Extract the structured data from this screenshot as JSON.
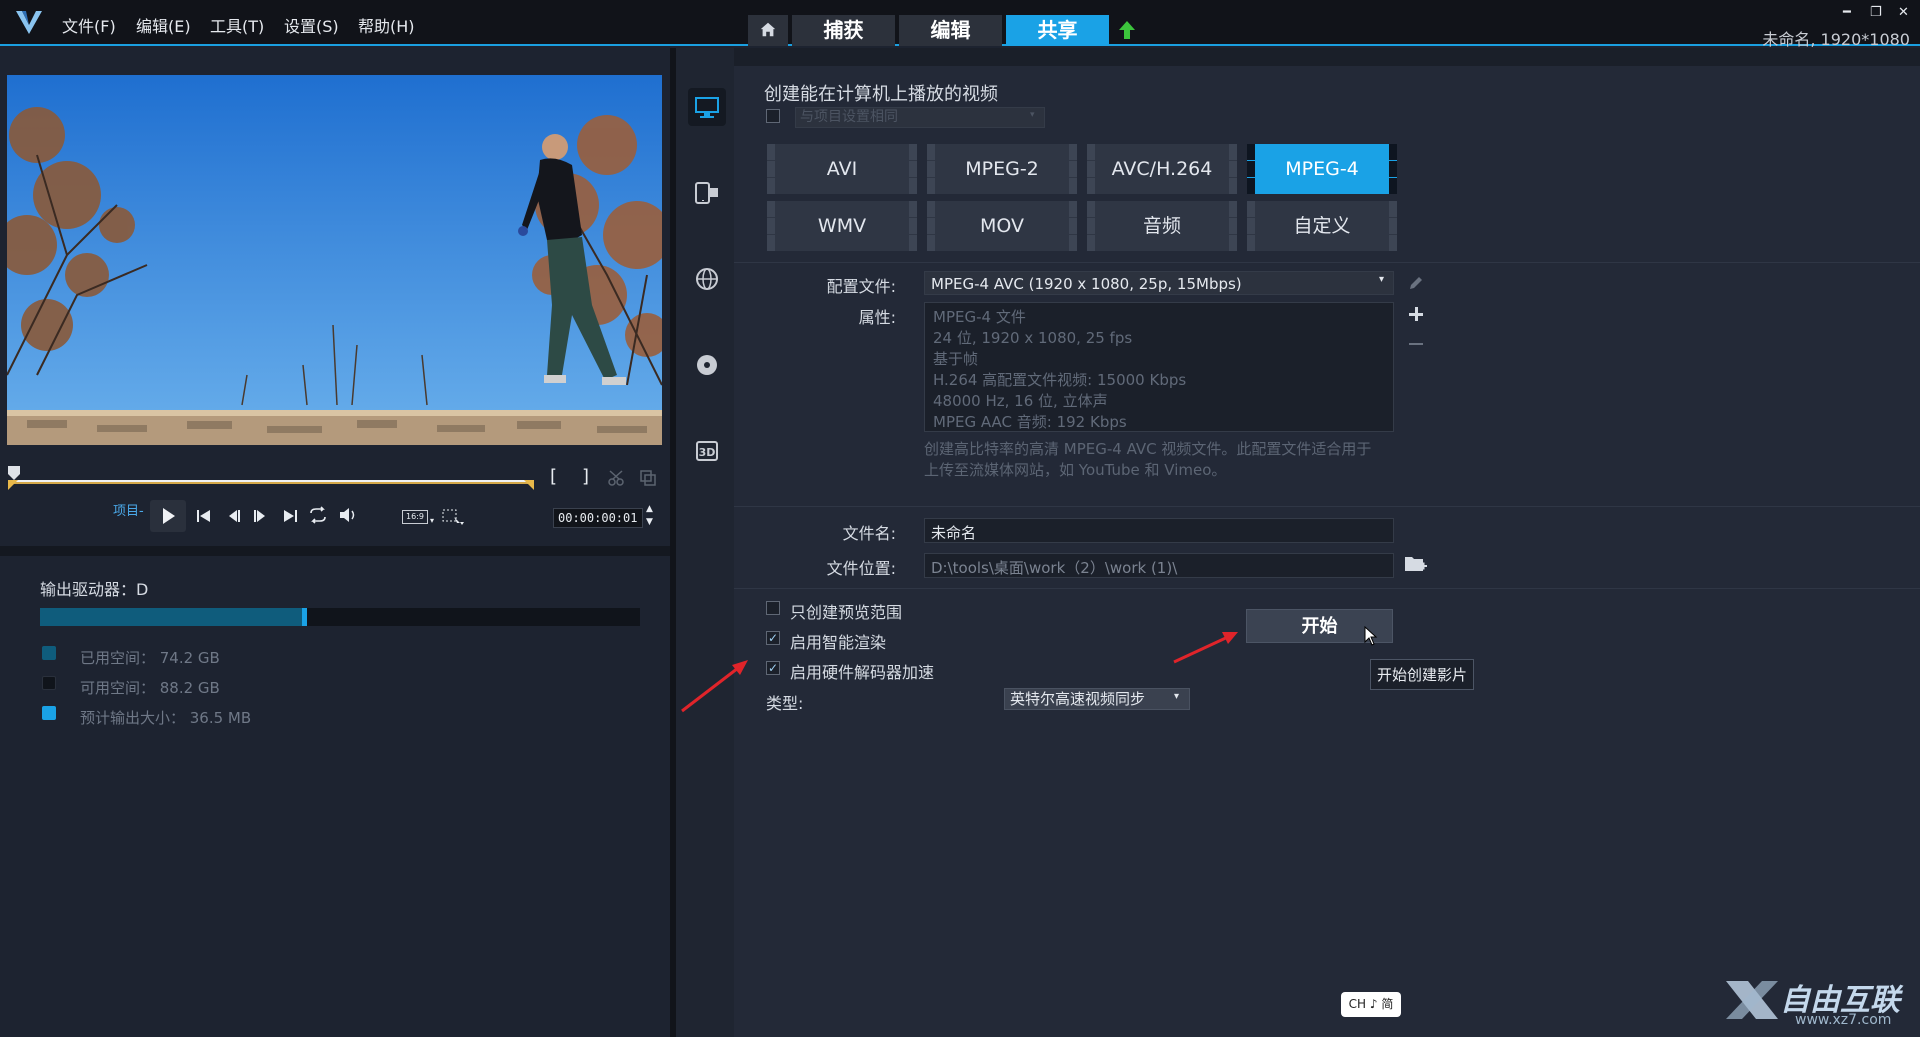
{
  "menubar": {
    "file": "文件(F)",
    "edit": "编辑(E)",
    "tools": "工具(T)",
    "settings": "设置(S)",
    "help": "帮助(H)"
  },
  "modes": {
    "capture": "捕获",
    "edit": "编辑",
    "share": "共享"
  },
  "project_info": "未命名, 1920*1080",
  "player": {
    "project_label": "项目-",
    "aspect": "16:9",
    "timecode": "00:00:00:01"
  },
  "drive": {
    "label": "输出驱动器：D",
    "used_fraction": 0.44,
    "legend": [
      {
        "text": "已用空间：  74.2 GB",
        "color": "#0f5c7c"
      },
      {
        "text": "可用空间：  88.2 GB",
        "color": "#10141b"
      },
      {
        "text": "预计输出大小：  36.5 MB",
        "color": "#1aa2e6"
      }
    ]
  },
  "share": {
    "heading": "创建能在计算机上播放的视频",
    "same_as_project": "与项目设置相同",
    "formats_row1": [
      "AVI",
      "MPEG-2",
      "AVC/H.264",
      "MPEG-4"
    ],
    "formats_row2": [
      "WMV",
      "MOV",
      "音频",
      "自定义"
    ],
    "selected_format": "MPEG-4",
    "profile_label": "配置文件:",
    "profile_value": "MPEG-4 AVC (1920 x 1080, 25p, 15Mbps)",
    "properties_label": "属性:",
    "properties": [
      "MPEG-4 文件",
      "24 位, 1920 x 1080, 25 fps",
      "基于帧",
      "H.264 高配置文件视频: 15000 Kbps",
      "48000 Hz, 16 位, 立体声",
      "MPEG AAC 音频: 192 Kbps"
    ],
    "description_line1": "创建高比特率的高清 MPEG-4 AVC 视频文件。此配置文件适合用于",
    "description_line2": "上传至流媒体网站，如 YouTube 和 Vimeo。",
    "filename_label": "文件名:",
    "filename_value": "未命名",
    "location_label": "文件位置:",
    "location_value": "D:\\tools\\桌面\\work（2）\\work (1)\\",
    "opt_preview_only": "只创建预览范围",
    "opt_smart_render": "启用智能渲染",
    "opt_hw_decoder": "启用硬件解码器加速",
    "type_label": "类型:",
    "type_value": "英特尔高速视频同步",
    "start_button": "开始",
    "tooltip": "开始创建影片"
  },
  "ime": "CH ♪ 简",
  "watermark": "自由互联",
  "watermark_url": "www.xz7.com"
}
